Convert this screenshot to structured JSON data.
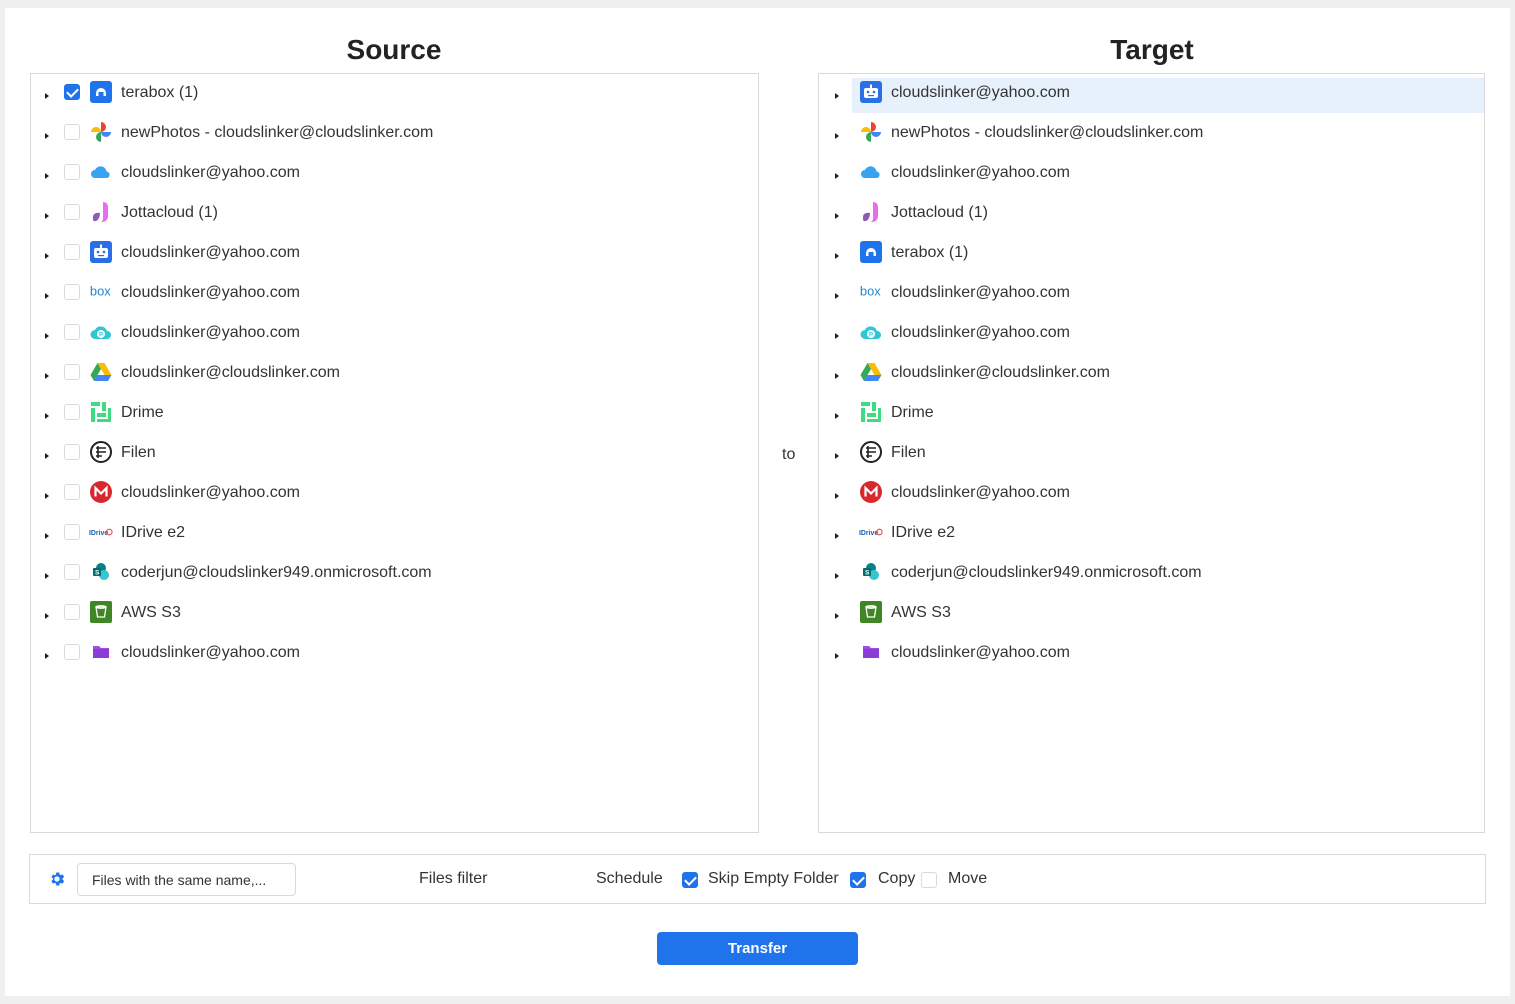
{
  "source": {
    "title": "Source",
    "items": [
      {
        "label": "terabox (1)",
        "icon": "terabox-icon",
        "checked": true
      },
      {
        "label": "newPhotos - cloudslinker@cloudslinker.com",
        "icon": "google-photos-icon",
        "checked": false
      },
      {
        "label": "cloudslinker@yahoo.com",
        "icon": "icloud-icon",
        "checked": false
      },
      {
        "label": "Jottacloud (1)",
        "icon": "jottacloud-icon",
        "checked": false
      },
      {
        "label": "cloudslinker@yahoo.com",
        "icon": "robot-icon",
        "checked": false
      },
      {
        "label": "cloudslinker@yahoo.com",
        "icon": "box-icon",
        "checked": false
      },
      {
        "label": "cloudslinker@yahoo.com",
        "icon": "pcloud-icon",
        "checked": false
      },
      {
        "label": "cloudslinker@cloudslinker.com",
        "icon": "google-drive-icon",
        "checked": false
      },
      {
        "label": "Drime",
        "icon": "drime-icon",
        "checked": false
      },
      {
        "label": "Filen",
        "icon": "filen-icon",
        "checked": false
      },
      {
        "label": "cloudslinker@yahoo.com",
        "icon": "mega-icon",
        "checked": false
      },
      {
        "label": "IDrive e2",
        "icon": "idrive-icon",
        "checked": false
      },
      {
        "label": "coderjun@cloudslinker949.onmicrosoft.com",
        "icon": "sharepoint-icon",
        "checked": false
      },
      {
        "label": "AWS S3",
        "icon": "aws-s3-icon",
        "checked": false
      },
      {
        "label": "cloudslinker@yahoo.com",
        "icon": "folder-icon",
        "checked": false
      }
    ]
  },
  "connector": "to",
  "target": {
    "title": "Target",
    "items": [
      {
        "label": "cloudslinker@yahoo.com",
        "icon": "robot-icon",
        "selected": true
      },
      {
        "label": "newPhotos - cloudslinker@cloudslinker.com",
        "icon": "google-photos-icon"
      },
      {
        "label": "cloudslinker@yahoo.com",
        "icon": "icloud-icon"
      },
      {
        "label": "Jottacloud (1)",
        "icon": "jottacloud-icon"
      },
      {
        "label": "terabox (1)",
        "icon": "terabox-icon"
      },
      {
        "label": "cloudslinker@yahoo.com",
        "icon": "box-icon"
      },
      {
        "label": "cloudslinker@yahoo.com",
        "icon": "pcloud-icon"
      },
      {
        "label": "cloudslinker@cloudslinker.com",
        "icon": "google-drive-icon"
      },
      {
        "label": "Drime",
        "icon": "drime-icon"
      },
      {
        "label": "Filen",
        "icon": "filen-icon"
      },
      {
        "label": "cloudslinker@yahoo.com",
        "icon": "mega-icon"
      },
      {
        "label": "IDrive e2",
        "icon": "idrive-icon"
      },
      {
        "label": "coderjun@cloudslinker949.onmicrosoft.com",
        "icon": "sharepoint-icon"
      },
      {
        "label": "AWS S3",
        "icon": "aws-s3-icon"
      },
      {
        "label": "cloudslinker@yahoo.com",
        "icon": "folder-icon"
      }
    ]
  },
  "options": {
    "settings_icon": "gear-icon",
    "duplicate_value": "Files with the same name,...",
    "files_filter": "Files filter",
    "schedule": "Schedule",
    "skip_empty_folder": {
      "label": "Skip Empty Folder",
      "checked": true
    },
    "copy": {
      "label": "Copy",
      "checked": true
    },
    "move": {
      "label": "Move",
      "checked": false
    }
  },
  "transfer_label": "Transfer",
  "colors": {
    "accent": "#1f74eb",
    "selected_row": "#e6f1fc",
    "border": "#d9d9d9"
  }
}
